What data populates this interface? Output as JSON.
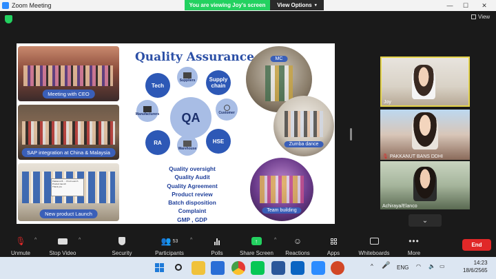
{
  "window": {
    "title": "Zoom Meeting"
  },
  "banner": {
    "viewing": "You are viewing Joy's screen",
    "view_options": "View Options"
  },
  "view_label": "View",
  "slide": {
    "title": "Quality Assurance",
    "photo_captions": [
      "Meeting with CEO",
      "SAP integration at China & Malaysia",
      "New product Launch"
    ],
    "center": "QA",
    "nodes_dark": [
      "Tech",
      "Supply chain",
      "RA",
      "HSE"
    ],
    "nodes_light": [
      "Suppliers",
      "Manufacturers",
      "Customer",
      "Warehouse"
    ],
    "list": [
      "Quality oversight",
      "Quality Audit",
      "Quality Agreement",
      "Product review",
      "Batch disposition",
      "Complaint",
      "GMP , GDP"
    ],
    "round_labels": [
      "MC",
      "Zumba dance",
      "Team building"
    ],
    "poster_lines": [
      "Pakkanut B. ... Prod Launch",
      "Product launch",
      "Thank you"
    ]
  },
  "participants": [
    {
      "name": "Joy",
      "highlight": "#e5d44a"
    },
    {
      "name": "PAKKANUT BANS DDHI"
    },
    {
      "name": "Achiraya/Elanco"
    }
  ],
  "toolbar": {
    "unmute": "Unmute",
    "stop_video": "Stop Video",
    "security": "Security",
    "participants": "Participants",
    "participant_count": "53",
    "polls": "Polls",
    "share_screen": "Share Screen",
    "reactions": "Reactions",
    "apps": "Apps",
    "whiteboards": "Whiteboards",
    "more": "More",
    "end": "End"
  },
  "tray": {
    "lang": "ENG",
    "time": "14:23",
    "date": "18/6/2565"
  },
  "colors": {
    "accent_blue": "#2d58b6",
    "green": "#23d160",
    "end_red": "#e02828"
  }
}
